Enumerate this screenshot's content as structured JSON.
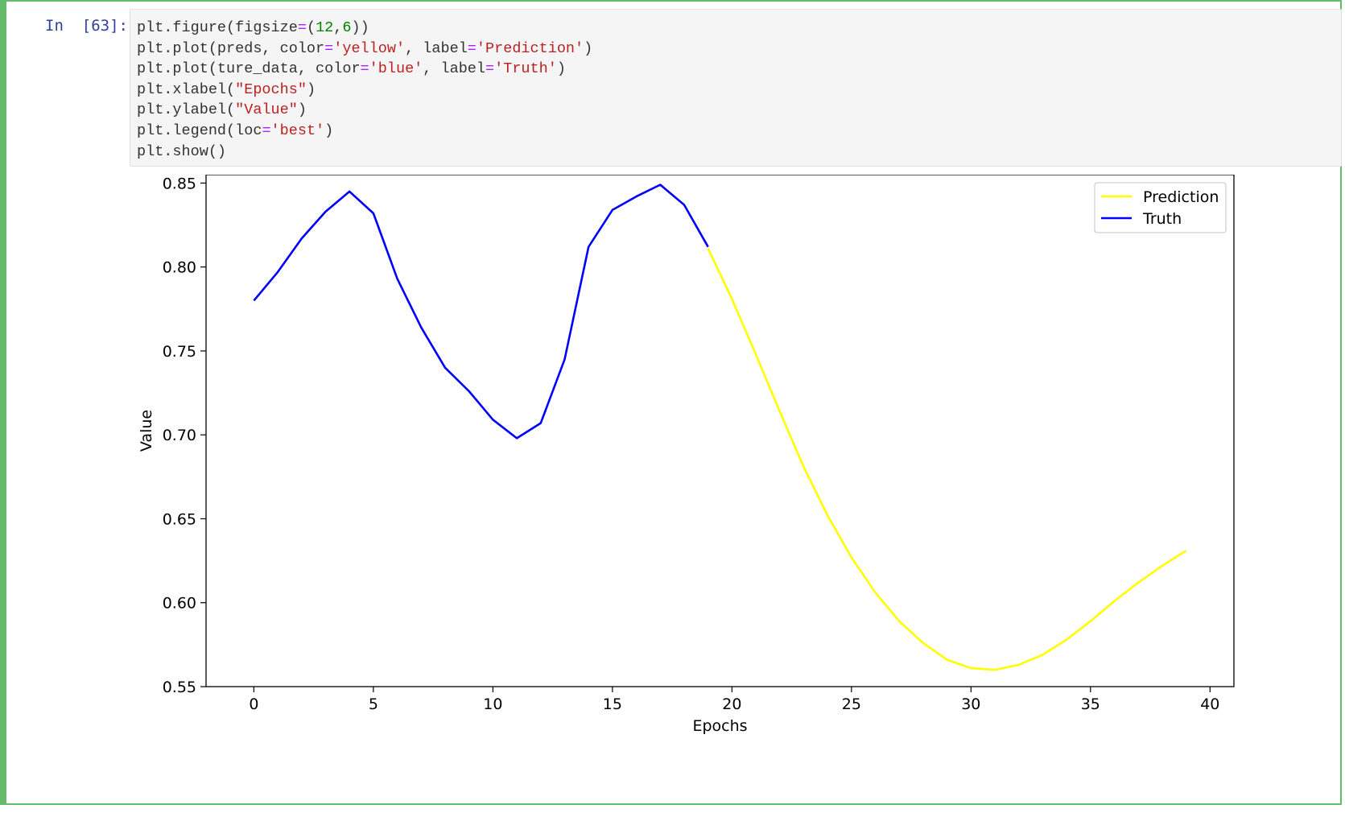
{
  "cell": {
    "prompt": "In  [63]:",
    "code_lines": [
      [
        {
          "t": "plt.figure(figsize",
          "c": "k"
        },
        {
          "t": "=",
          "c": "op"
        },
        {
          "t": "(",
          "c": "k"
        },
        {
          "t": "12",
          "c": "num"
        },
        {
          "t": ",",
          "c": "k"
        },
        {
          "t": "6",
          "c": "num"
        },
        {
          "t": "))",
          "c": "k"
        }
      ],
      [
        {
          "t": "plt.plot(preds, color",
          "c": "k"
        },
        {
          "t": "=",
          "c": "op"
        },
        {
          "t": "'yellow'",
          "c": "str"
        },
        {
          "t": ", label",
          "c": "k"
        },
        {
          "t": "=",
          "c": "op"
        },
        {
          "t": "'Prediction'",
          "c": "str"
        },
        {
          "t": ")",
          "c": "k"
        }
      ],
      [
        {
          "t": "plt.plot(ture_data, color",
          "c": "k"
        },
        {
          "t": "=",
          "c": "op"
        },
        {
          "t": "'blue'",
          "c": "str"
        },
        {
          "t": ", label",
          "c": "k"
        },
        {
          "t": "=",
          "c": "op"
        },
        {
          "t": "'Truth'",
          "c": "str"
        },
        {
          "t": ")",
          "c": "k"
        }
      ],
      [
        {
          "t": "plt.xlabel(",
          "c": "k"
        },
        {
          "t": "\"Epochs\"",
          "c": "str"
        },
        {
          "t": ")",
          "c": "k"
        }
      ],
      [
        {
          "t": "plt.ylabel(",
          "c": "k"
        },
        {
          "t": "\"Value\"",
          "c": "str"
        },
        {
          "t": ")",
          "c": "k"
        }
      ],
      [
        {
          "t": "plt.legend(loc",
          "c": "k"
        },
        {
          "t": "=",
          "c": "op"
        },
        {
          "t": "'best'",
          "c": "str"
        },
        {
          "t": ")",
          "c": "k"
        }
      ],
      [
        {
          "t": "plt.show()",
          "c": "k"
        }
      ]
    ]
  },
  "colors": {
    "cell_border": "#66bb6a",
    "prompt": "#303f9f",
    "code_bg": "#f5f5f5"
  },
  "chart_data": {
    "type": "line",
    "title": "",
    "xlabel": "Epochs",
    "ylabel": "Value",
    "xlim": [
      -2,
      41
    ],
    "ylim": [
      0.55,
      0.855
    ],
    "xticks": [
      0,
      5,
      10,
      15,
      20,
      25,
      30,
      35,
      40
    ],
    "yticks": [
      0.55,
      0.6,
      0.65,
      0.7,
      0.75,
      0.8,
      0.85
    ],
    "ytick_labels": [
      "0.55",
      "0.60",
      "0.65",
      "0.70",
      "0.75",
      "0.80",
      "0.85"
    ],
    "grid": false,
    "legend": "top-right",
    "series": [
      {
        "name": "Prediction",
        "color": "#ffff00",
        "x": [
          19,
          20,
          21,
          22,
          23,
          24,
          25,
          26,
          27,
          28,
          29,
          30,
          31,
          32,
          33,
          34,
          35,
          36,
          37,
          38,
          39
        ],
        "y": [
          0.811,
          0.781,
          0.748,
          0.714,
          0.681,
          0.652,
          0.627,
          0.606,
          0.589,
          0.576,
          0.566,
          0.561,
          0.56,
          0.563,
          0.569,
          0.578,
          0.589,
          0.601,
          0.612,
          0.622,
          0.631
        ]
      },
      {
        "name": "Truth",
        "color": "#0000ff",
        "x": [
          0,
          1,
          2,
          3,
          4,
          5,
          6,
          7,
          8,
          9,
          10,
          11,
          12,
          13,
          14,
          15,
          16,
          17,
          18,
          19
        ],
        "y": [
          0.78,
          0.797,
          0.817,
          0.833,
          0.845,
          0.832,
          0.793,
          0.764,
          0.74,
          0.726,
          0.709,
          0.698,
          0.707,
          0.745,
          0.812,
          0.834,
          0.842,
          0.849,
          0.837,
          0.812
        ]
      }
    ]
  }
}
